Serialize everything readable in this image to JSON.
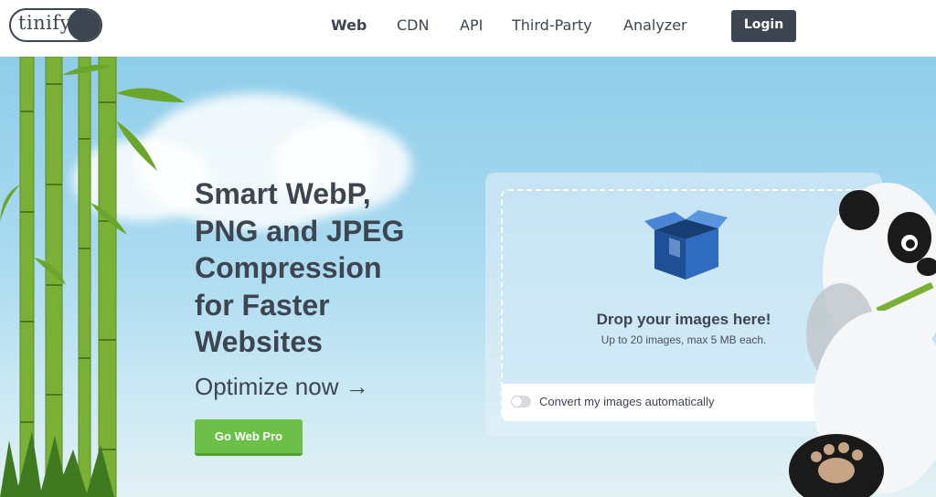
{
  "logo": {
    "text": "tinify"
  },
  "nav": {
    "items": [
      {
        "label": "Web",
        "active": true
      },
      {
        "label": "CDN",
        "active": false
      },
      {
        "label": "API",
        "active": false
      },
      {
        "label": "Third-Party",
        "active": false
      },
      {
        "label": "Analyzer",
        "active": false
      }
    ],
    "login_label": "Login"
  },
  "hero": {
    "headline_lines": [
      "Smart WebP,",
      "PNG and JPEG",
      "Compression",
      "for Faster",
      "Websites"
    ],
    "optimize_text": "Optimize now",
    "optimize_arrow": "→",
    "cta_label": "Go Web Pro"
  },
  "upload": {
    "title": "Drop your images here!",
    "subtitle": "Up to 20 images, max 5 MB each.",
    "toggle_label": "Convert my images automatically",
    "toggle_on": false
  },
  "colors": {
    "text_dark": "#3d4550",
    "cta_green": "#6cc04a",
    "sky_top": "#8fcde9",
    "box_blue": "#2d5fa8"
  },
  "icons": [
    "box-icon",
    "arrow-right-icon",
    "panda-illustration",
    "bamboo-illustration"
  ]
}
